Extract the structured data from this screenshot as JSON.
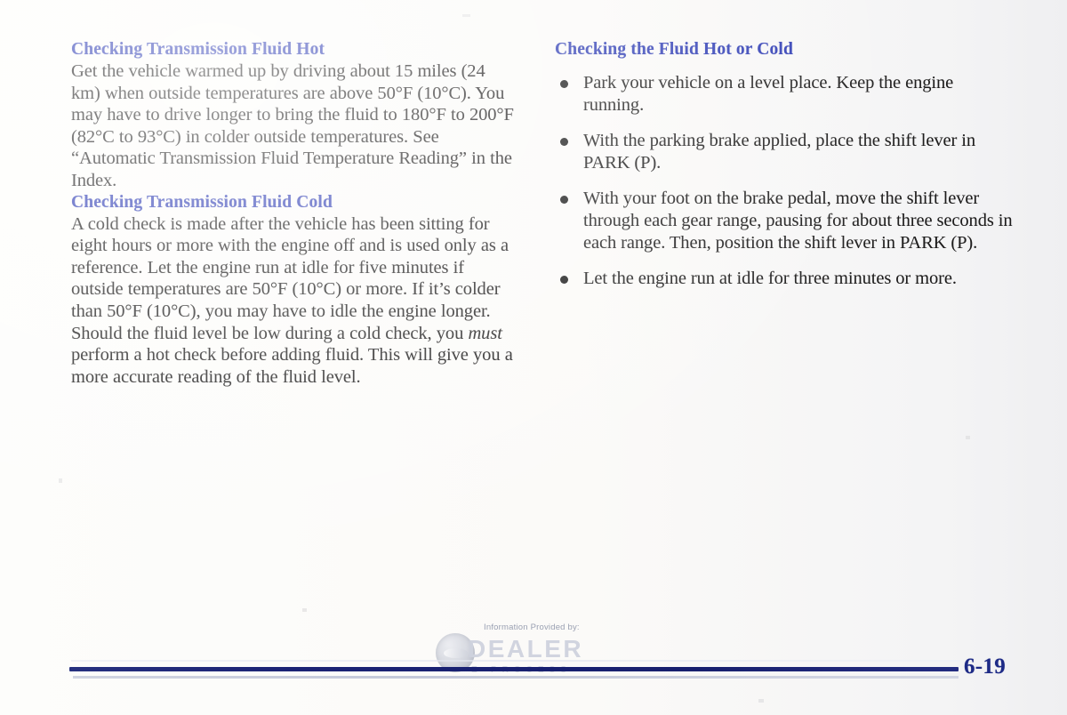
{
  "page": {
    "number": "6-19",
    "background_color": "#fbfaf8",
    "heading_color": "#2e3cb4",
    "rule_color": "#1b2375",
    "page_number_color": "#1d2a86"
  },
  "left_column": {
    "heading_1": "Checking Transmission Fluid Hot",
    "paragraph_1": "Get the vehicle warmed up by driving about 15 miles (24 km) when outside temperatures are above 50°F (10°C). You may have to drive longer to bring the fluid to 180°F to 200°F (82°C to 93°C) in colder outside temperatures. See “Automatic Transmission Fluid Temperature Reading” in the Index.",
    "heading_2": "Checking Transmission Fluid Cold",
    "paragraph_2_part_1": "A cold check is made after the vehicle has been sitting for eight hours or more with the engine off and is used only as a reference. Let the engine run at idle for five minutes if outside temperatures are 50°F (10°C) or more. If it’s colder than 50°F (10°C), you may have to idle the engine longer. Should the fluid level be low during a cold check, you ",
    "paragraph_2_emphasis": "must",
    "paragraph_2_part_2": " perform a hot check before adding fluid. This will give you a more accurate reading of the fluid level."
  },
  "right_column": {
    "heading": "Checking the Fluid Hot or Cold",
    "bullets": [
      "Park your vehicle on a level place. Keep the engine running.",
      "With the parking brake applied, place the shift lever in PARK (P).",
      "With your foot on the brake pedal, move the shift lever through each gear range, pausing for about three seconds in each range. Then, position the shift lever in PARK (P).",
      "Let the engine run at idle for three minutes or more."
    ]
  },
  "footer": {
    "watermark_caption": "Information Provided by:",
    "watermark_brand": "DEALER",
    "watermark_tagline": "E-PROCESS"
  }
}
